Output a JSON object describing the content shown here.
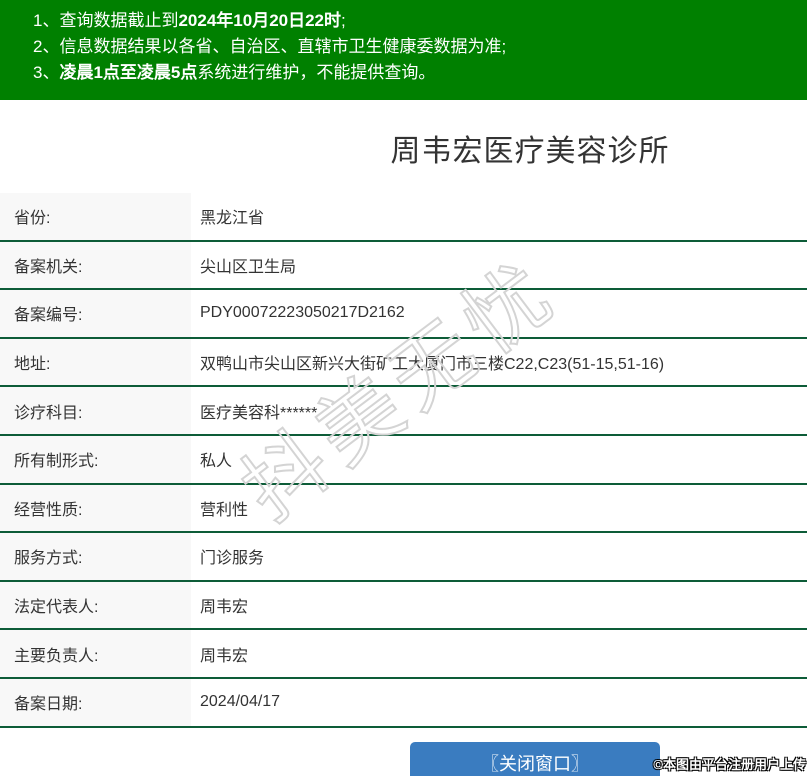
{
  "notice": {
    "items": [
      {
        "num": "1、",
        "pre": "查询数据截止到",
        "bold": "2024年10月20日22时",
        "post": ";"
      },
      {
        "num": "2、",
        "pre": "信息数据结果以各省、自治区、直辖市卫生健康委数据为准;",
        "bold": "",
        "post": ""
      },
      {
        "num": "3、",
        "pre": "",
        "bold": "凌晨1点至凌晨5点",
        "post": "系统进行维护，不能提供查询。"
      }
    ]
  },
  "page": {
    "title": "周韦宏医疗美容诊所"
  },
  "table": {
    "rows": [
      {
        "label": "省份:",
        "value": "黑龙江省"
      },
      {
        "label": "备案机关:",
        "value": "尖山区卫生局"
      },
      {
        "label": "备案编号:",
        "value": "PDY00072223050217D2162"
      },
      {
        "label": "地址:",
        "value": "双鸭山市尖山区新兴大街矿工大厦门市三楼C22,C23(51-15,51-16)"
      },
      {
        "label": "诊疗科目:",
        "value": "医疗美容科******"
      },
      {
        "label": "所有制形式:",
        "value": "私人"
      },
      {
        "label": "经营性质:",
        "value": "营利性"
      },
      {
        "label": "服务方式:",
        "value": "门诊服务"
      },
      {
        "label": "法定代表人:",
        "value": "周韦宏"
      },
      {
        "label": "主要负责人:",
        "value": "周韦宏"
      },
      {
        "label": "备案日期:",
        "value": "2024/04/17"
      }
    ]
  },
  "watermarks": {
    "diagonal": "抖美无忧",
    "corner": "©本图由平台注册用户上传"
  },
  "actions": {
    "close_label": "〖关闭窗口〗"
  },
  "colors": {
    "header_bg": "#008000",
    "divider": "#0d5c38",
    "label_bg": "#f8f8f8",
    "button_bg": "#3a7cc0",
    "watermark_stroke": "#d4d4d4",
    "text": "#333333"
  }
}
